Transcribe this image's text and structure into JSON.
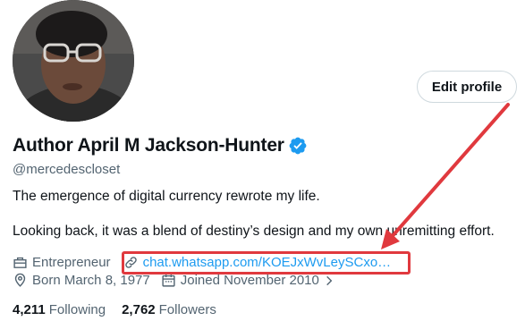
{
  "profile": {
    "display_name": "Author April M Jackson-Hunter",
    "handle": "@mercedescloset",
    "bio_line1": "The emergence of digital currency rewrote my life.",
    "bio_line2": "Looking back, it was a blend of destiny’s design and my own unremitting effort.",
    "profession": "Entrepreneur",
    "link": "chat.whatsapp.com/KOEJxWvLeySCxo…",
    "born": "Born March 8, 1977",
    "joined": "Joined November 2010",
    "following_count": "4,211",
    "following_label": "Following",
    "followers_count": "2,762",
    "followers_label": "Followers"
  },
  "actions": {
    "edit_profile_label": "Edit profile"
  },
  "colors": {
    "link": "#1d9bf0",
    "verified": "#1d9bf0",
    "annotation": "#e0393e",
    "secondary_text": "#536471"
  },
  "icons": [
    "briefcase-icon",
    "link-icon",
    "location-icon",
    "calendar-icon",
    "chevron-right-icon",
    "verified-badge-icon"
  ]
}
